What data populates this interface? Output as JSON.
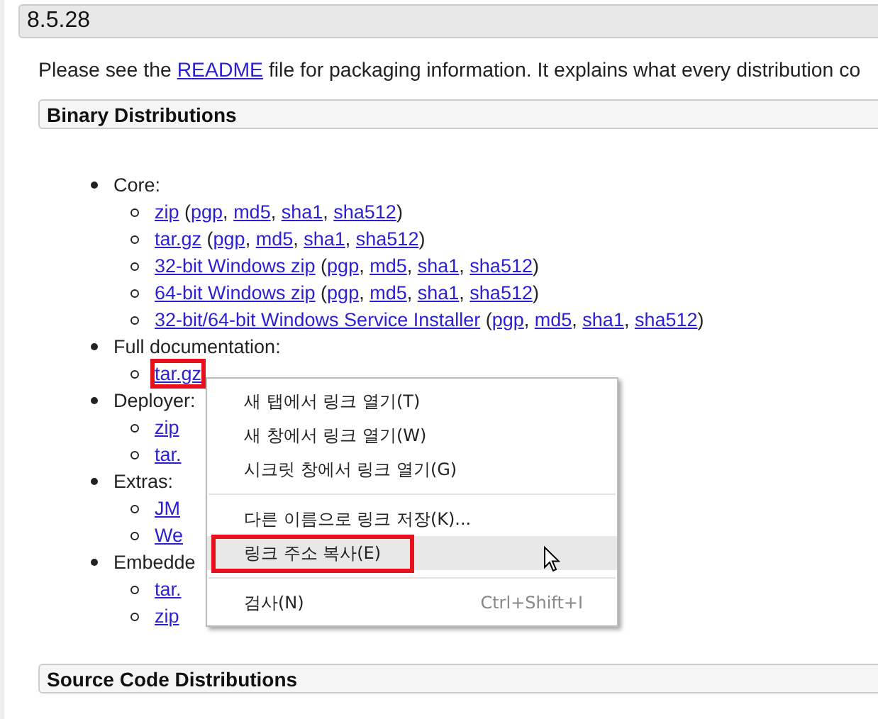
{
  "version_heading": "8.5.28",
  "intro": {
    "before": "Please see the ",
    "link": "README",
    "after": " file for packaging information. It explains what every distribution co"
  },
  "sections": [
    {
      "title": "Binary Distributions",
      "groups": [
        {
          "label": "Core:",
          "rows": [
            {
              "links": [
                "zip",
                "pgp",
                "md5",
                "sha1",
                "sha512"
              ],
              "separators": [
                " (",
                ", ",
                ", ",
                ", ",
                ")"
              ],
              "highlighted": false
            },
            {
              "links": [
                "tar.gz",
                "pgp",
                "md5",
                "sha1",
                "sha512"
              ],
              "separators": [
                " (",
                ", ",
                ", ",
                ", ",
                ")"
              ],
              "highlighted": false
            },
            {
              "links": [
                "32-bit Windows zip",
                "pgp",
                "md5",
                "sha1",
                "sha512"
              ],
              "separators": [
                " (",
                ", ",
                ", ",
                ", ",
                ")"
              ],
              "highlighted": false
            },
            {
              "links": [
                "64-bit Windows zip",
                "pgp",
                "md5",
                "sha1",
                "sha512"
              ],
              "separators": [
                " (",
                ", ",
                ", ",
                ", ",
                ")"
              ],
              "highlighted": false
            },
            {
              "links": [
                "32-bit/64-bit Windows Service Installer",
                "pgp",
                "md5",
                "sha1",
                "sha512"
              ],
              "separators": [
                " (",
                ", ",
                ", ",
                ", ",
                ")"
              ],
              "highlighted": false
            }
          ]
        },
        {
          "label": "Full documentation:",
          "rows": [
            {
              "links": [
                "tar.gz"
              ],
              "separators": [],
              "highlighted": true
            }
          ]
        },
        {
          "label": "Deployer:",
          "rows": [
            {
              "links": [
                "zip"
              ],
              "separators": [],
              "highlighted": false
            },
            {
              "links": [
                "tar."
              ],
              "separators": [],
              "highlighted": false
            }
          ]
        },
        {
          "label": "Extras:",
          "rows": [
            {
              "links": [
                "JM"
              ],
              "separators": [],
              "highlighted": false
            },
            {
              "links": [
                "We"
              ],
              "separators": [],
              "highlighted": false
            }
          ]
        },
        {
          "label": "Embedde",
          "rows": [
            {
              "links": [
                "tar."
              ],
              "separators": [],
              "highlighted": false
            },
            {
              "links": [
                "zip"
              ],
              "separators": [],
              "highlighted": false
            }
          ]
        }
      ]
    },
    {
      "title": "Source Code Distributions"
    }
  ],
  "context_menu": [
    {
      "kind": "item",
      "label": "새 탭에서 링크 열기(T)",
      "selected": false,
      "highlighted": false
    },
    {
      "kind": "item",
      "label": "새 창에서 링크 열기(W)",
      "selected": false,
      "highlighted": false
    },
    {
      "kind": "item",
      "label": "시크릿 창에서 링크 열기(G)",
      "selected": false,
      "highlighted": false
    },
    {
      "kind": "separator"
    },
    {
      "kind": "item",
      "label": "다른 이름으로 링크 저장(K)...",
      "selected": false,
      "highlighted": false
    },
    {
      "kind": "item",
      "label": "링크 주소 복사(E)",
      "selected": true,
      "highlighted": true
    },
    {
      "kind": "separator"
    },
    {
      "kind": "item",
      "label": "검사(N)",
      "shortcut": "Ctrl+Shift+I",
      "selected": false,
      "highlighted": false
    }
  ]
}
